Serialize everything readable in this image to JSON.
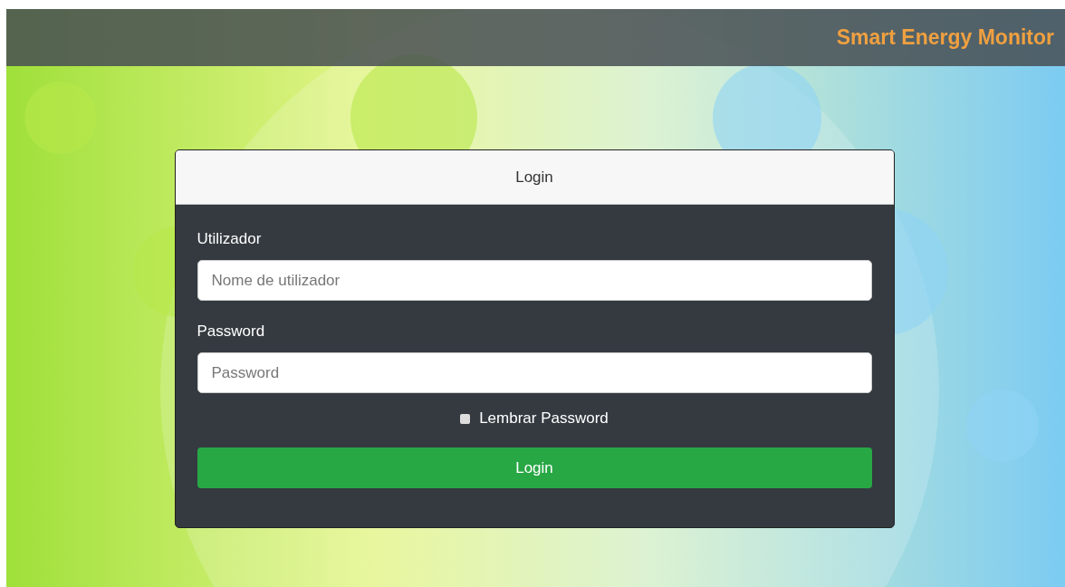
{
  "navbar": {
    "brand": "Smart Energy Monitor"
  },
  "login_card": {
    "header": "Login",
    "fields": [
      {
        "label": "Utilizador",
        "placeholder": "Nome de utilizador"
      },
      {
        "label": "Password",
        "placeholder": "Password"
      }
    ],
    "remember": {
      "label": "Lembrar Password",
      "checked": false
    },
    "submit": "Login"
  }
}
